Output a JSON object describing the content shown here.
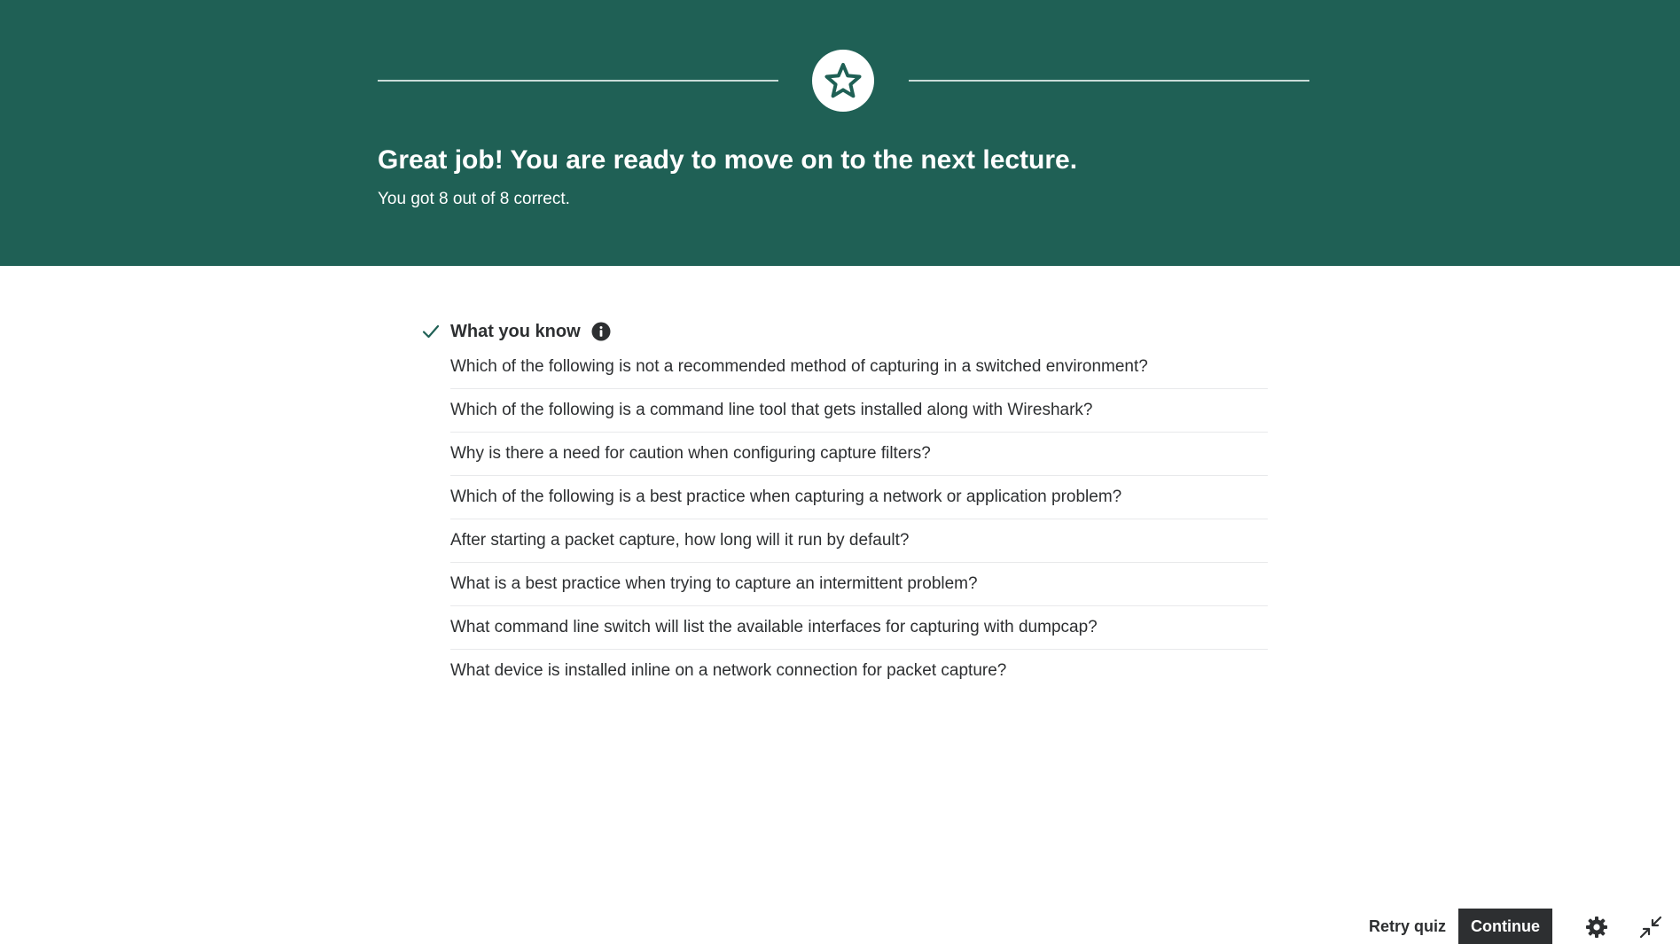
{
  "colors": {
    "banner_bg": "#1f6055",
    "accent_check": "#1f6055",
    "text_dark": "#2d2f31"
  },
  "banner": {
    "icon": "star-icon",
    "title": "Great job! You are ready to move on to the next lecture.",
    "subtitle": "You got 8 out of 8 correct."
  },
  "section": {
    "icon": "check-icon",
    "title": "What you know",
    "info_icon": "info-icon",
    "questions": [
      "Which of the following is not a recommended method of capturing in a switched environment?",
      "Which of the following is a command line tool that gets installed along with Wireshark?",
      "Why is there a need for caution when configuring capture filters?",
      "Which of the following is a best practice when capturing a network or application problem?",
      "After starting a packet capture, how long will it run by default?",
      "What is a best practice when trying to capture an intermittent problem?",
      "What command line switch will list the available interfaces for capturing with dumpcap?",
      "What device is installed inline on a network connection for packet capture?"
    ]
  },
  "footer": {
    "retry_label": "Retry quiz",
    "continue_label": "Continue",
    "settings_icon": "gear-icon",
    "collapse_icon": "collapse-icon"
  }
}
